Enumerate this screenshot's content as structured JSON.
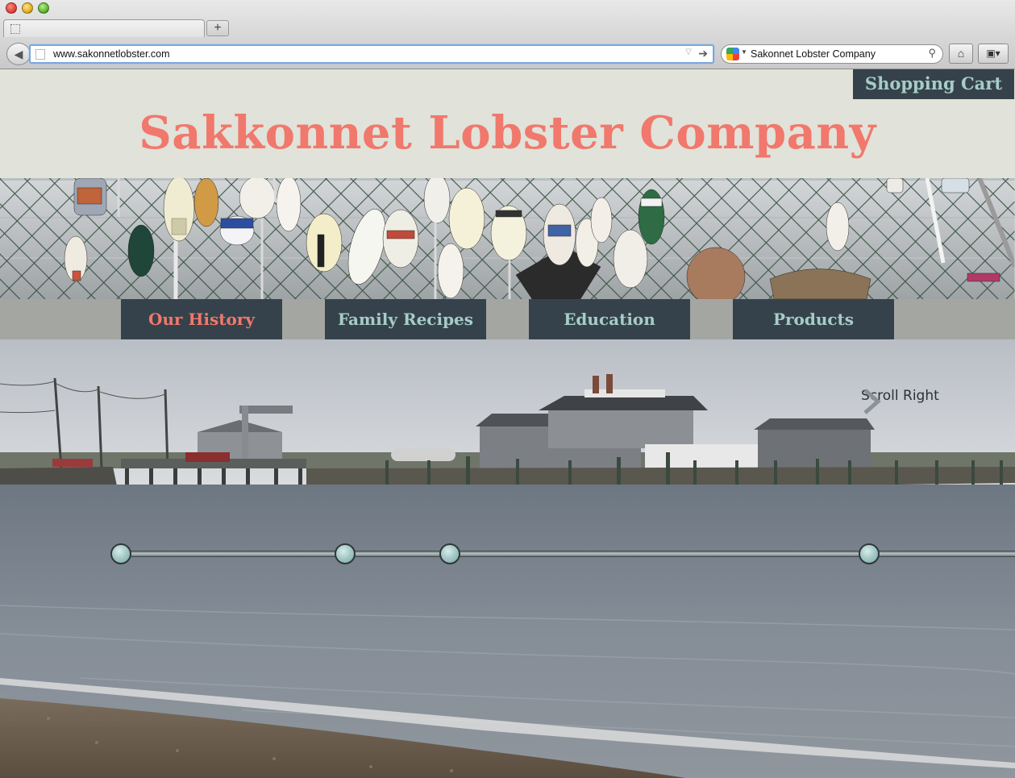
{
  "browser": {
    "url": "www.sakonnetlobster.com",
    "search_text": "Sakonnet Lobster Company",
    "new_tab_label": "+"
  },
  "header": {
    "cart_label": "Shopping Cart",
    "site_title": "Sakkonnet Lobster Company"
  },
  "nav": {
    "items": [
      {
        "label": "Our History",
        "active": true
      },
      {
        "label": "Family Recipes",
        "active": false
      },
      {
        "label": "Education",
        "active": false
      },
      {
        "label": "Products",
        "active": false
      }
    ]
  },
  "hero": {
    "scroll_label": "Scroll Right",
    "timeline_nodes": 4
  },
  "colors": {
    "title_salmon": "#f1786c",
    "nav_dark": "#36424b",
    "nav_text_teal": "#a6cdc7",
    "header_bg": "#e1e2d9"
  },
  "icons": [
    "back-arrow-icon",
    "page-icon",
    "go-arrow-icon",
    "google-icon",
    "search-magnifier-icon",
    "home-icon",
    "bookmark-icon",
    "chevron-right-icon"
  ]
}
